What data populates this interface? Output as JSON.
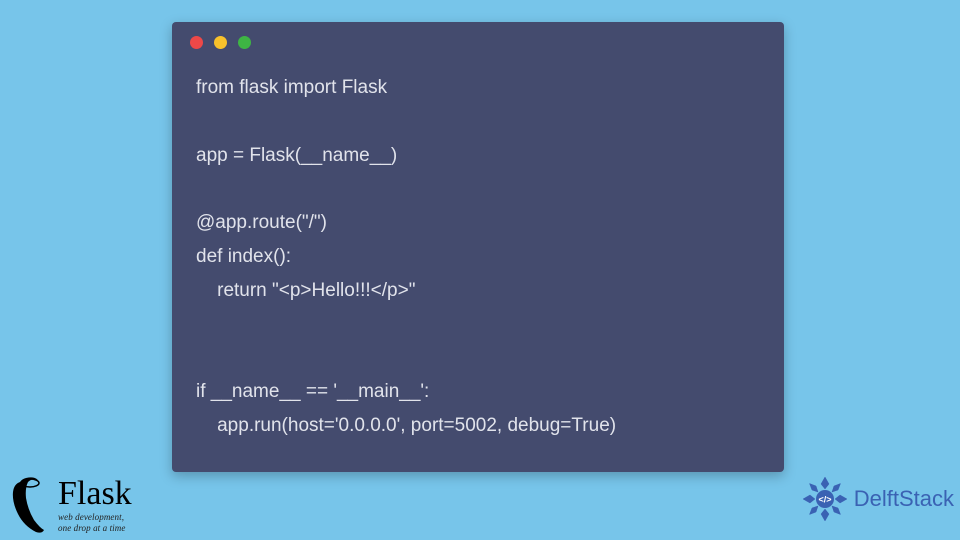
{
  "code": {
    "lines": [
      "from flask import Flask",
      "",
      "app = Flask(__name__)",
      "",
      "@app.route(\"/\")",
      "def index():",
      "    return \"<p>Hello!!!</p>\"",
      "",
      "",
      "if __name__ == '__main__':",
      "    app.run(host='0.0.0.0', port=5002, debug=True)"
    ]
  },
  "flask_logo": {
    "title": "Flask",
    "subtitle1": "web development,",
    "subtitle2": "one drop at a time"
  },
  "delftstack_logo": {
    "text": "DelftStack"
  }
}
